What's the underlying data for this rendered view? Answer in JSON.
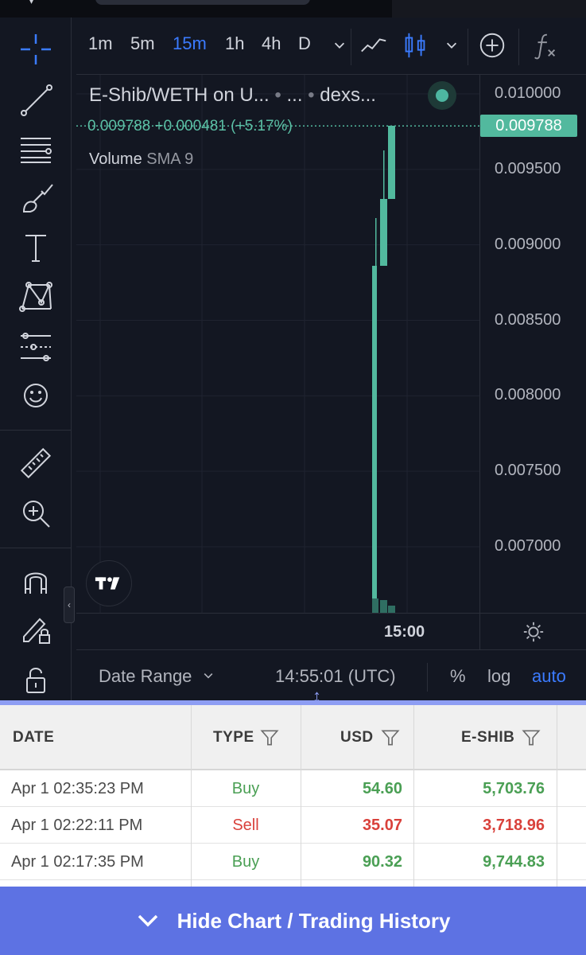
{
  "toolbar": {
    "timeframes": [
      "1m",
      "5m",
      "15m",
      "1h",
      "4h",
      "D"
    ],
    "active_timeframe": "15m"
  },
  "legend": {
    "symbol": "E-Shib/WETH on U...",
    "dot1": "•",
    "ellipsis": "...",
    "source": "dexs...",
    "ohlc": "0.009788 +0.000481 (+5.17%)",
    "volume_label": "Volume",
    "volume_indicator": "SMA 9"
  },
  "price_axis": {
    "current_price": "0.009788",
    "labels": [
      "0.010000",
      "0.009500",
      "0.009000",
      "0.008500",
      "0.008000",
      "0.007500",
      "0.007000"
    ]
  },
  "time_axis": {
    "label": "15:00"
  },
  "bottom_bar": {
    "date_range": "Date Range",
    "clock": "14:55:01 (UTC)",
    "percent": "%",
    "log": "log",
    "auto": "auto"
  },
  "table": {
    "headers": {
      "date": "DATE",
      "type": "TYPE",
      "usd": "USD",
      "token": "E-SHIB"
    },
    "rows": [
      {
        "date": "Apr 1 02:35:23 PM",
        "type": "Buy",
        "usd": "54.60",
        "token": "5,703.76"
      },
      {
        "date": "Apr 1 02:22:11 PM",
        "type": "Sell",
        "usd": "35.07",
        "token": "3,718.96"
      },
      {
        "date": "Apr 1 02:17:35 PM",
        "type": "Buy",
        "usd": "90.32",
        "token": "9,744.83"
      }
    ]
  },
  "footer": {
    "hide_label": "Hide Chart / Trading History"
  },
  "colors": {
    "up": "#52b99e",
    "accent": "#3b7bff",
    "buy": "#4a9f54",
    "sell": "#d9413b",
    "footer": "#5d72e3"
  },
  "icons": [
    "crosshair-icon",
    "trend-line-icon",
    "fib-lines-icon",
    "brush-icon",
    "text-icon",
    "pattern-icon",
    "prediction-icon",
    "emoji-icon",
    "ruler-icon",
    "zoom-in-icon",
    "magnet-icon",
    "lock-draw-icon",
    "lock-icon",
    "line-chart-icon",
    "candles-icon",
    "add-indicator-icon",
    "fx-icon",
    "settings-gear-icon",
    "filter-icon",
    "chevron-down-icon"
  ]
}
